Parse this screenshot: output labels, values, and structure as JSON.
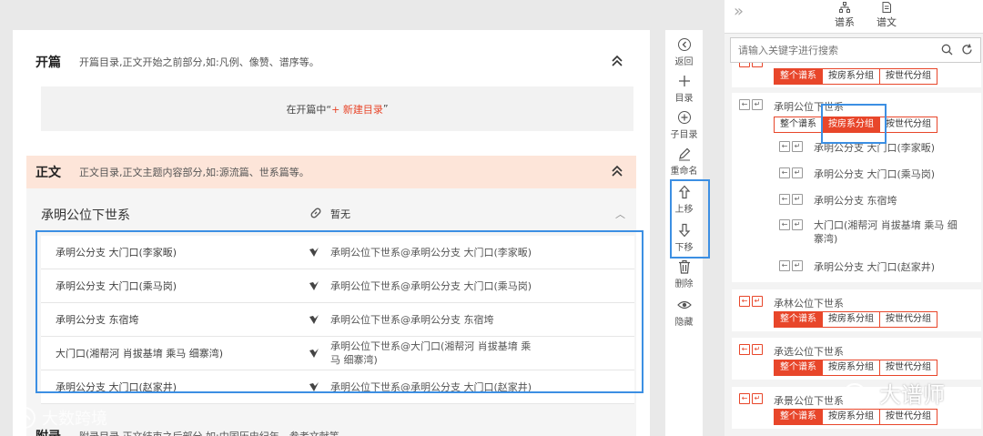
{
  "main": {
    "kaipian": {
      "title": "开篇",
      "desc": "开篇目录,正文开始之前部分,如:凡例、像赞、谱序等。",
      "box_prefix": "在开篇中“",
      "box_link": "+ 新建目录",
      "box_suffix": "”"
    },
    "zhengwen": {
      "title": "正文",
      "desc": "正文目录,正文主题内容部分,如:源流篇、世系篇等。"
    },
    "group": {
      "title": "承明公位下世系",
      "link_label": "暂无",
      "rows": [
        {
          "name": "承明公分支 大门口(李家畈)",
          "path": "承明公位下世系@承明公分支 大门口(李家畈)"
        },
        {
          "name": "承明公分支 大门口(乘马岗)",
          "path": "承明公位下世系@承明公分支 大门口(乘马岗)"
        },
        {
          "name": "承明公分支 东宿垮",
          "path": "承明公位下世系@承明公分支 东宿垮"
        },
        {
          "name": "大门口(湘帮河 肖拔基堉 乘马 细寨湾)",
          "path": "承明公位下世系@大门口(湘帮河 肖拔基堉 乘马 细寨湾)"
        },
        {
          "name": "承明公分支 大门口(赵家井)",
          "path": "承明公位下世系@承明公分支 大门口(赵家井)"
        }
      ]
    },
    "fulu": {
      "title": "附录",
      "desc": "附录目录,正文结束之后部分,如:中国历史纪年、参考文献等。"
    }
  },
  "toolbar": {
    "back": "返回",
    "dir": "目录",
    "subdir": "子目录",
    "rename": "重命名",
    "up": "上移",
    "down": "下移",
    "delete": "删除",
    "hide": "隐藏"
  },
  "panel": {
    "tabs": [
      "谱系",
      "谱文"
    ],
    "search_placeholder": "请输入关键字进行搜索",
    "btn_labels": [
      "整个谱系",
      "按房系分组",
      "按世代分组"
    ],
    "cards": [
      {
        "title": "承明公位下世系",
        "subs": [
          "承明公分支 大门口(李家畈)",
          "承明公分支 大门口(乘马岗)",
          "承明公分支 东宿垮",
          "大门口(湘帮河 肖拔基堉 乘马 细寨湾)",
          "承明公分支 大门口(赵家井)"
        ]
      },
      {
        "title": "承林公位下世系"
      },
      {
        "title": "承选公位下世系"
      },
      {
        "title": "承景公位下世系"
      }
    ]
  },
  "watermarks": {
    "left": "大数跨境",
    "right": "大谱师"
  },
  "colors": {
    "accent": "#e8462a",
    "highlight": "#3c8fe3",
    "zhengwen_bg": "#fde5d9"
  }
}
